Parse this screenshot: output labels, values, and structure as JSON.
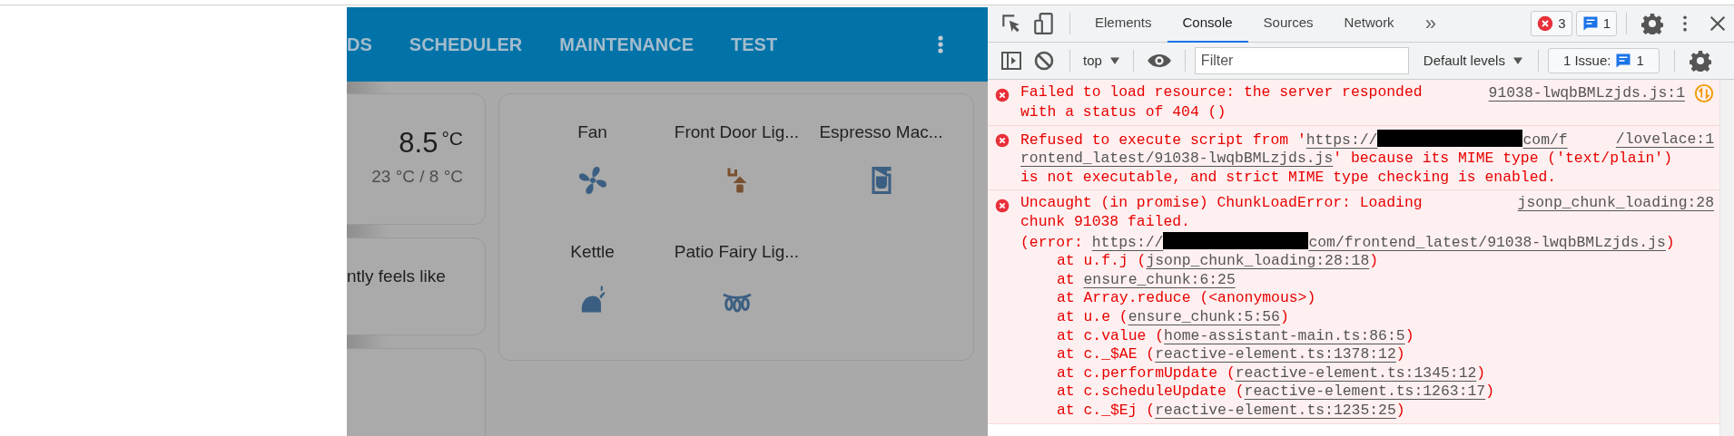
{
  "app": {
    "tabs": [
      {
        "label": "DS",
        "selected": false
      },
      {
        "label": "SCHEDULER",
        "selected": false
      },
      {
        "label": "MAINTENANCE",
        "selected": false
      },
      {
        "label": "TEST",
        "selected": false
      }
    ],
    "weather_card": {
      "temperature": "8.5",
      "unit": "°C",
      "high_low": "23 °C / 8 °C"
    },
    "feels_like_card": {
      "text": "ntly feels like"
    },
    "entities": [
      {
        "name": "Fan",
        "kind": "fan",
        "on": false
      },
      {
        "name": "Front Door Lig...",
        "kind": "lamp",
        "on": true
      },
      {
        "name": "Espresso Mac...",
        "kind": "coffee",
        "on": false
      },
      {
        "name": "Kettle",
        "kind": "kettle",
        "on": false
      },
      {
        "name": "Patio Fairy Lig...",
        "kind": "lights",
        "on": false
      }
    ]
  },
  "devtools": {
    "tabs": [
      {
        "label": "Elements",
        "selected": false
      },
      {
        "label": "Console",
        "selected": true
      },
      {
        "label": "Sources",
        "selected": false
      },
      {
        "label": "Network",
        "selected": false
      }
    ],
    "more_tabs": "»",
    "error_count": "3",
    "message_count": "1",
    "context": "top",
    "filter_placeholder": "Filter",
    "levels": "Default levels",
    "issues_label": "1 Issue:",
    "issues_count": "1",
    "messages": [
      {
        "source": "91038-lwqbBMLzjds.js:1",
        "network_request": true,
        "lines": [
          [
            {
              "kind": "text",
              "s": "Failed to load resource: the server responded"
            }
          ],
          [
            {
              "kind": "text",
              "s": "with a status of 404 ()"
            }
          ]
        ]
      },
      {
        "source": "/lovelace:1",
        "network_request": false,
        "lines": [
          [
            {
              "kind": "text",
              "s": "Refused to execute script from '"
            },
            {
              "kind": "link",
              "s": "https://"
            },
            {
              "kind": "redacted"
            },
            {
              "kind": "link",
              "s": "com/f"
            }
          ],
          [
            {
              "kind": "link",
              "s": "rontend_latest/91038-lwqbBMLzjds.js"
            },
            {
              "kind": "text",
              "s": "' because its MIME type ('text/plain')"
            }
          ],
          [
            {
              "kind": "text",
              "s": "is not executable, and strict MIME type checking is enabled."
            }
          ]
        ]
      },
      {
        "source": "jsonp_chunk_loading:28",
        "network_request": false,
        "lines": [
          [
            {
              "kind": "text",
              "s": "Uncaught (in promise) ChunkLoadError: Loading"
            }
          ],
          [
            {
              "kind": "text",
              "s": "chunk 91038 failed."
            }
          ],
          [
            {
              "kind": "text",
              "s": "(error: "
            },
            {
              "kind": "link",
              "s": "https://"
            },
            {
              "kind": "redacted"
            },
            {
              "kind": "link",
              "s": "com/frontend_latest/91038-lwqbBMLzjds.js"
            },
            {
              "kind": "text",
              "s": ")"
            }
          ]
        ],
        "stack": [
          {
            "prefix": "at u.f.j (",
            "link": "jsonp_chunk_loading:28:18",
            "suffix": ")"
          },
          {
            "prefix": "at ",
            "link": "ensure_chunk:6:25"
          },
          {
            "prefix": "at Array.reduce (<anonymous>)"
          },
          {
            "prefix": "at u.e (",
            "link": "ensure_chunk:5:56",
            "suffix": ")"
          },
          {
            "prefix": "at c.value (",
            "link": "home-assistant-main.ts:86:5",
            "suffix": ")"
          },
          {
            "prefix": "at c._$AE (",
            "link": "reactive-element.ts:1378:12",
            "suffix": ")"
          },
          {
            "prefix": "at c.performUpdate (",
            "link": "reactive-element.ts:1345:12",
            "suffix": ")"
          },
          {
            "prefix": "at c.scheduleUpdate (",
            "link": "reactive-element.ts:1263:17",
            "suffix": ")"
          },
          {
            "prefix": "at c._$Ej (",
            "link": "reactive-element.ts:1235:25",
            "suffix": ")"
          }
        ]
      }
    ]
  }
}
